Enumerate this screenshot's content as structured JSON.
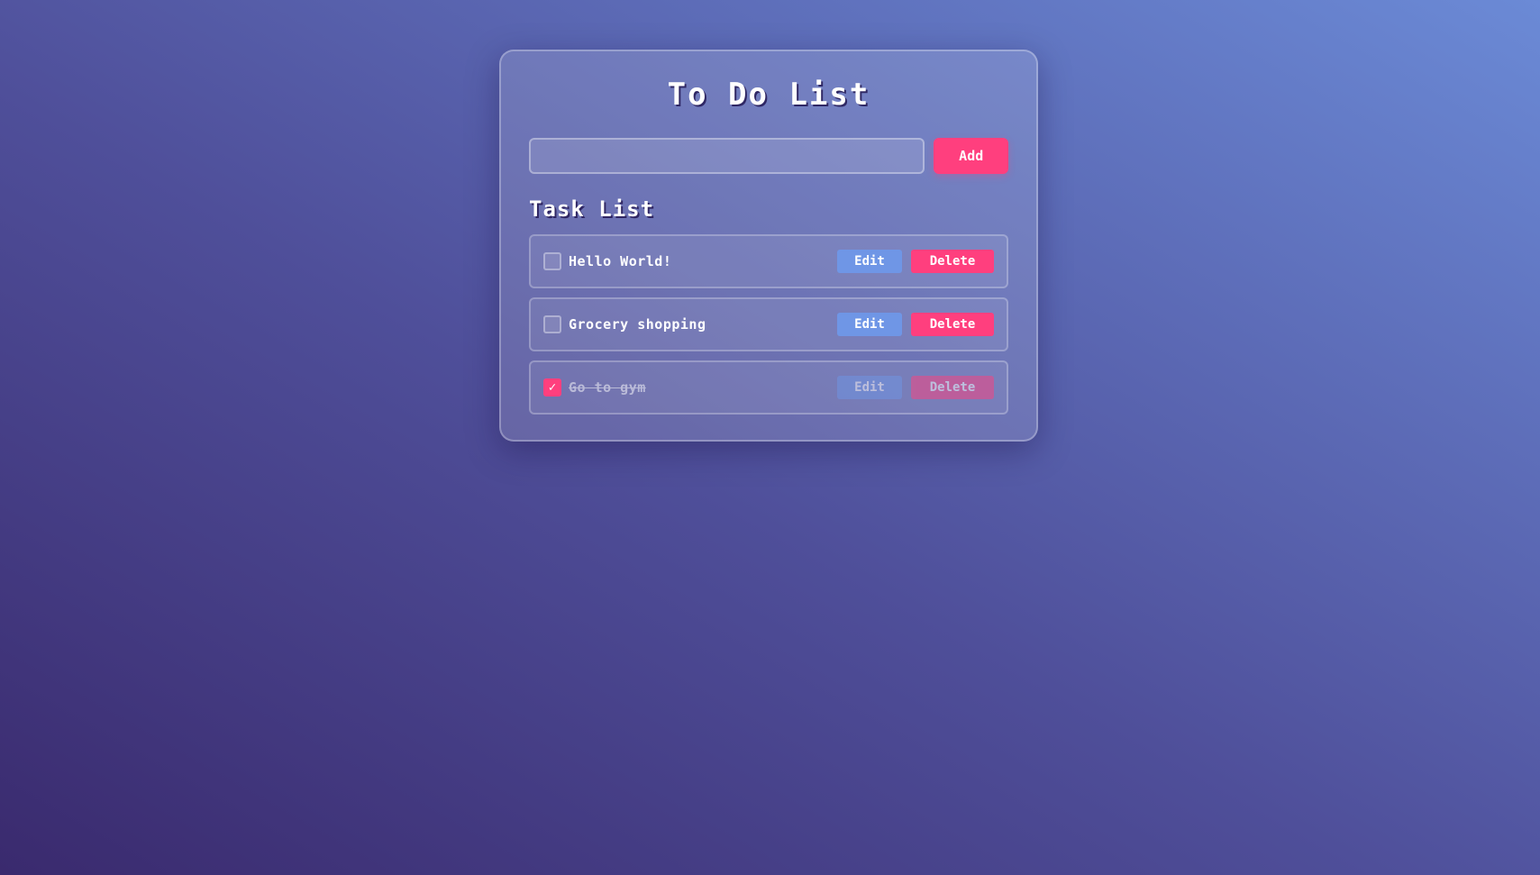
{
  "app": {
    "title": "To Do List"
  },
  "add_form": {
    "input_value": "",
    "input_placeholder": "",
    "add_label": "Add"
  },
  "task_list": {
    "heading": "Task List",
    "tasks": [
      {
        "text": "Hello World!",
        "completed": false,
        "edit_label": "Edit",
        "delete_label": "Delete"
      },
      {
        "text": "Grocery shopping",
        "completed": false,
        "edit_label": "Edit",
        "delete_label": "Delete"
      },
      {
        "text": "Go to gym",
        "completed": true,
        "check_mark": "✓",
        "edit_label": "Edit",
        "delete_label": "Delete"
      }
    ]
  },
  "colors": {
    "accent": "#ff3f7e",
    "edit": "#6f96e6",
    "background_start": "#3a2a6e",
    "background_end": "#6b8ad6"
  }
}
